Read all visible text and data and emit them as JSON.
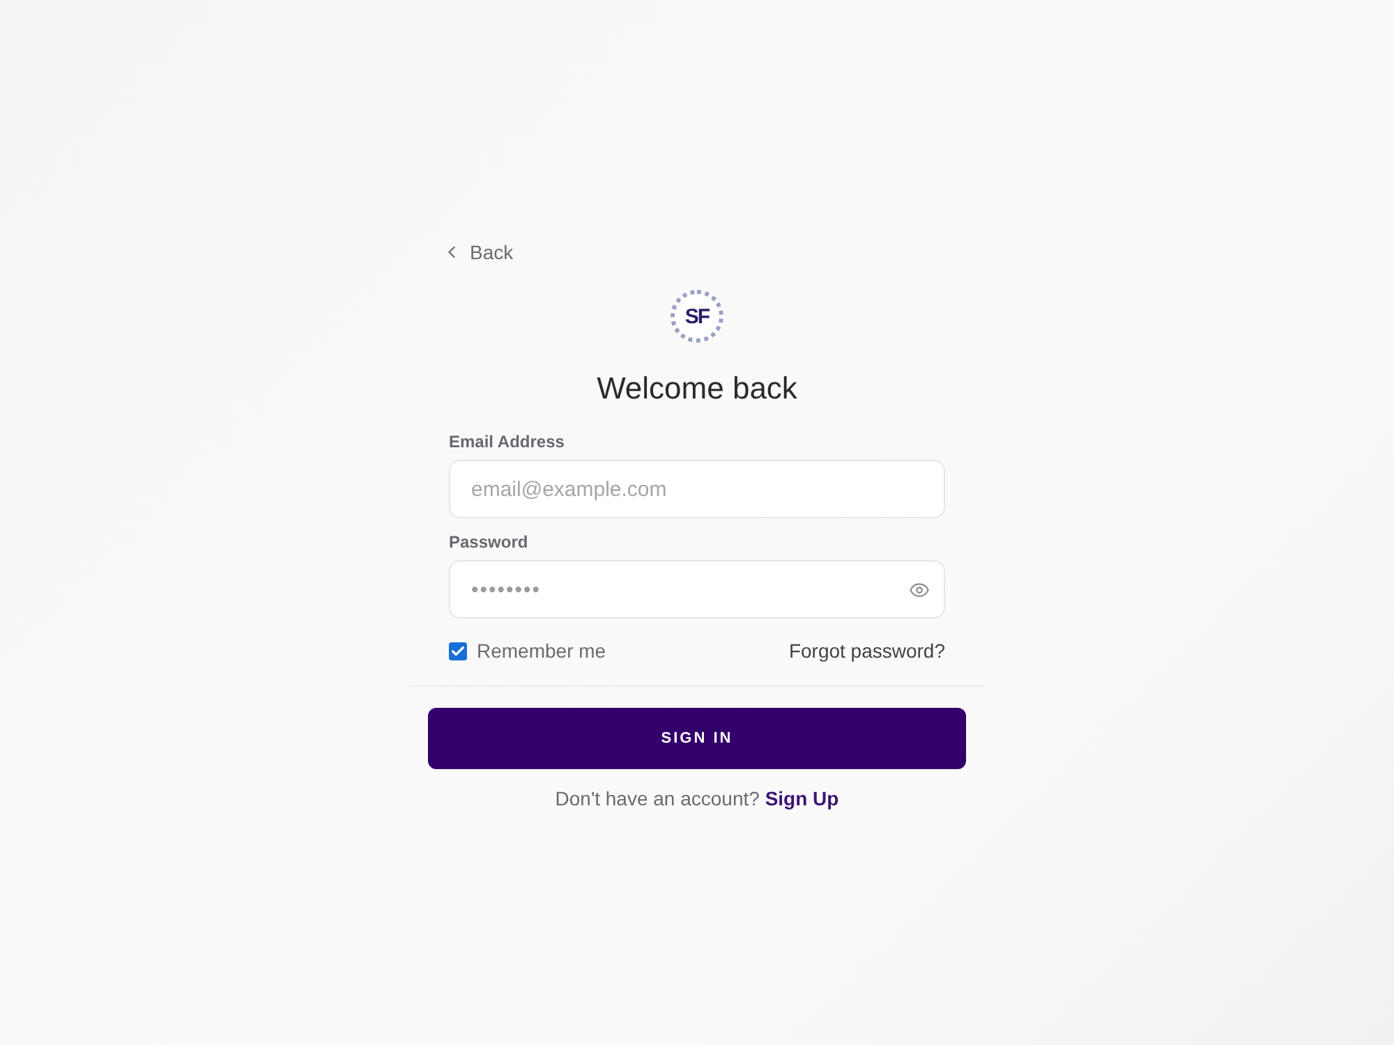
{
  "back_link": {
    "label": "Back"
  },
  "logo": {
    "text": "SF"
  },
  "title": "Welcome back",
  "fields": [
    {
      "kind": "text",
      "label": "Email Address",
      "placeholder": "email@example.com"
    },
    {
      "kind": "password",
      "label": "Password",
      "value": "••••••••"
    }
  ],
  "remember": {
    "label": "Remember me",
    "checked": true
  },
  "forgot_link": "Forgot password?",
  "submit_button": "SIGN IN",
  "signup": {
    "prompt": "Don't have an account?",
    "link": "Sign Up"
  }
}
